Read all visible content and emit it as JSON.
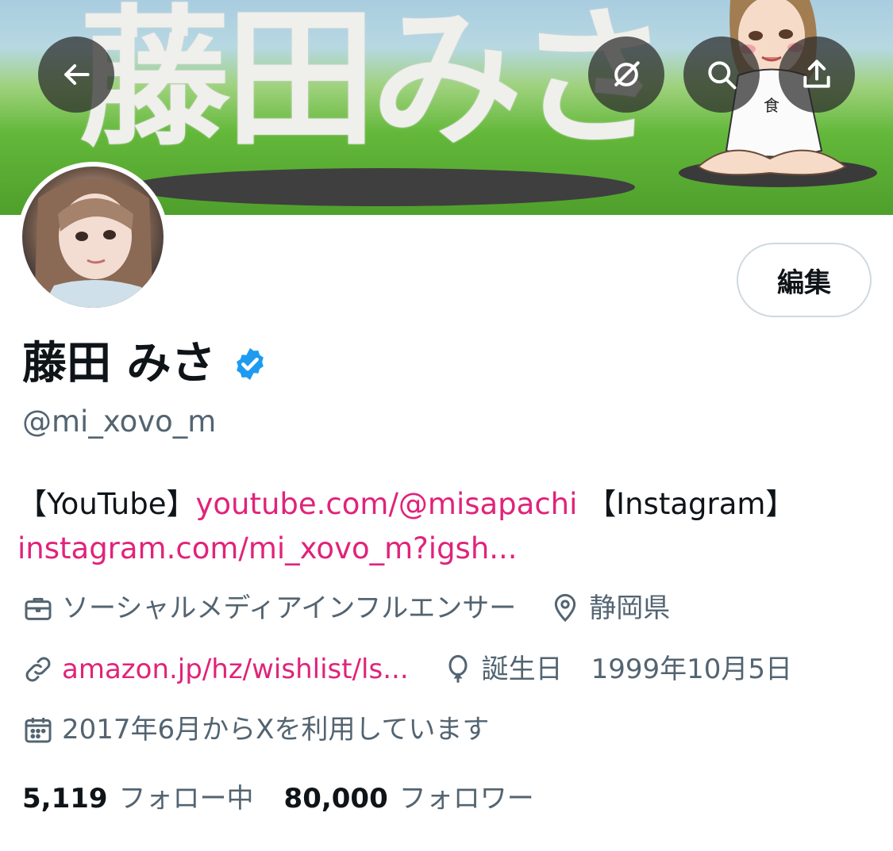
{
  "banner": {
    "text": "藤田みさ"
  },
  "nav": {
    "back_icon": "arrow-left-icon",
    "grok_icon": "grok-icon",
    "search_icon": "search-icon",
    "share_icon": "share-icon"
  },
  "profile": {
    "edit_label": "編集",
    "display_name": "藤田 みさ",
    "handle": "@mi_xovo_m",
    "verified": true,
    "accent_color": "#1d9bf0",
    "link_color": "#e0237a"
  },
  "bio": {
    "part1": "【YouTube】",
    "youtube_link": "youtube.com/@misapachi",
    "part2": "【Instagram】",
    "instagram_link": "instagram.com/mi_xovo_m?igsh..."
  },
  "meta": {
    "category": "ソーシャルメディアインフルエンサー",
    "location": "静岡県",
    "website": "amazon.jp/hz/wishlist/ls...",
    "birthday_label": "誕生日",
    "birthday": "1999年10月5日",
    "joined": "2017年6月からXを利用しています"
  },
  "stats": {
    "following_count": "5,119",
    "following_label": "フォロー中",
    "followers_count": "80,000",
    "followers_label": "フォロワー"
  }
}
